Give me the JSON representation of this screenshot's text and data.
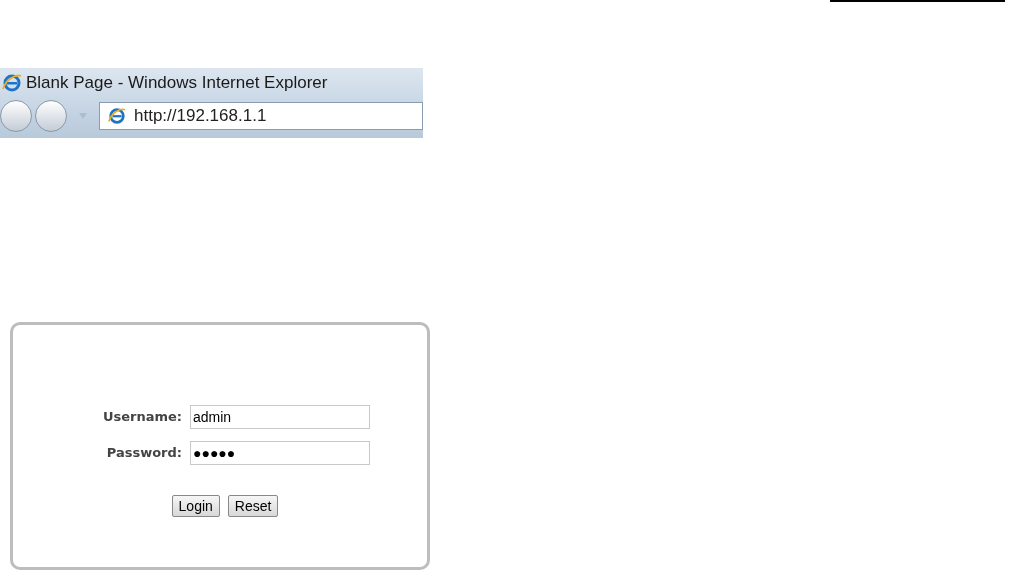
{
  "browser": {
    "title": "Blank Page - Windows Internet Explorer",
    "address": "http://192.168.1.1"
  },
  "login": {
    "fields": [
      {
        "label": "Username:",
        "value": "admin"
      },
      {
        "label": "Password:",
        "value": "●●●●●"
      }
    ],
    "buttons": [
      "Login",
      "Reset"
    ]
  }
}
